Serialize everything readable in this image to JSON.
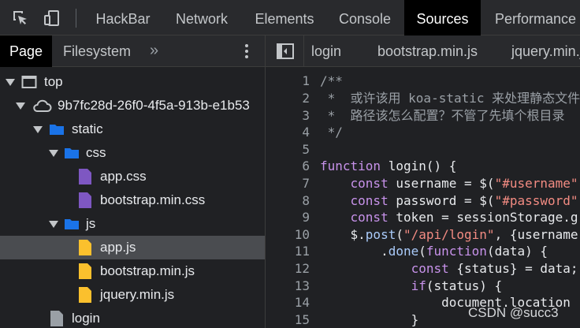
{
  "toolbar": {
    "tabs": [
      "HackBar",
      "Network",
      "Elements",
      "Console",
      "Sources",
      "Performance"
    ],
    "active_tab": "Sources"
  },
  "navigator": {
    "tabs": [
      "Page",
      "Filesystem"
    ],
    "more": "»",
    "tree": [
      {
        "label": "top",
        "icon": "frame-icon",
        "depth": 0,
        "expanded": true
      },
      {
        "label": "9b7fc28d-26f0-4f5a-913b-e1b53",
        "icon": "cloud-icon",
        "depth": 1,
        "expanded": true
      },
      {
        "label": "static",
        "icon": "folder-icon",
        "depth": 2,
        "expanded": true
      },
      {
        "label": "css",
        "icon": "folder-icon",
        "depth": 3,
        "expanded": true
      },
      {
        "label": "app.css",
        "icon": "css-file-icon",
        "depth": 4
      },
      {
        "label": "bootstrap.min.css",
        "icon": "css-file-icon",
        "depth": 4
      },
      {
        "label": "js",
        "icon": "folder-icon",
        "depth": 3,
        "expanded": true
      },
      {
        "label": "app.js",
        "icon": "js-file-icon",
        "depth": 4,
        "selected": true
      },
      {
        "label": "bootstrap.min.js",
        "icon": "js-file-icon",
        "depth": 4
      },
      {
        "label": "jquery.min.js",
        "icon": "js-file-icon",
        "depth": 4
      },
      {
        "label": "login",
        "icon": "document-icon",
        "depth": 2
      }
    ]
  },
  "editor": {
    "tabs": [
      "login",
      "bootstrap.min.js",
      "jquery.min.js"
    ],
    "lines": [
      {
        "n": "1",
        "text": "/**"
      },
      {
        "n": "2",
        "text": " *  或许该用 koa-static 来处理静态文件"
      },
      {
        "n": "3",
        "text": " *  路径该怎么配置？不管了先填个根目录"
      },
      {
        "n": "4",
        "text": " */"
      },
      {
        "n": "5",
        "text": ""
      },
      {
        "n": "6",
        "text": "function login() {"
      },
      {
        "n": "7",
        "text": "    const username = $(\"#username\""
      },
      {
        "n": "8",
        "text": "    const password = $(\"#password\""
      },
      {
        "n": "9",
        "text": "    const token = sessionStorage.g"
      },
      {
        "n": "10",
        "text": "    $.post(\"/api/login\", {username"
      },
      {
        "n": "11",
        "text": "        .done(function(data) {"
      },
      {
        "n": "12",
        "text": "            const {status} = data;"
      },
      {
        "n": "13",
        "text": "            if(status) {"
      },
      {
        "n": "14",
        "text": "                document.location"
      },
      {
        "n": "15",
        "text": "            }"
      }
    ]
  },
  "watermark": "CSDN @succ3",
  "colors": {
    "folder": "#1a73e8",
    "css_file": "#7e57c2",
    "js_file": "#fbc02d",
    "keyword": "#c792ea",
    "string": "#f28b82",
    "comment": "#9aa0a6"
  }
}
